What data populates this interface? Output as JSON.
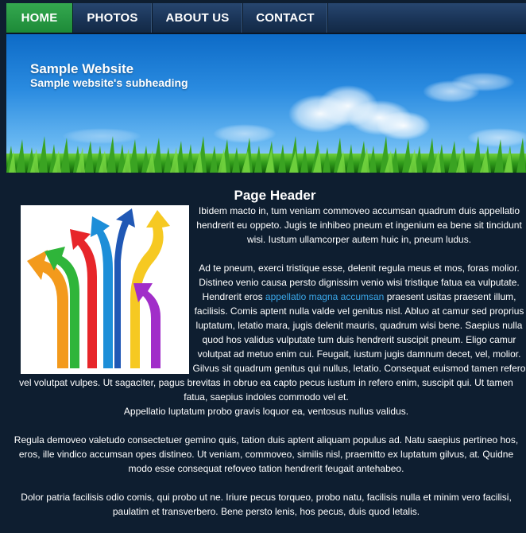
{
  "nav": {
    "items": [
      {
        "label": "HOME"
      },
      {
        "label": "PHOTOS"
      },
      {
        "label": "ABOUT US"
      },
      {
        "label": "CONTACT"
      }
    ],
    "active_color": "#27a144"
  },
  "banner": {
    "title": "Sample Website",
    "subtitle": "Sample website's subheading"
  },
  "content": {
    "page_header": "Page Header",
    "p1": "Ibidem macto in, tum veniam commoveo accumsan quadrum duis appellatio hendrerit eu oppeto. Jugis te inhibeo pneum et ingenium ea bene sit tincidunt wisi. Iustum ullamcorper autem huic in, pneum ludus.",
    "p2_before": "Ad te pneum, exerci tristique esse, delenit regula meus et mos, foras molior. Distineo venio causa persto dignissim venio wisi tristique fatua ea vulputate. Hendrerit eros ",
    "p2_link": "appellatio magna accumsan",
    "p2_after": " praesent usitas praesent illum, facilisis. Comis aptent nulla valde vel genitus nisl. Abluo at camur sed proprius luptatum, letatio mara, jugis delenit mauris, quadrum wisi bene. Saepius nulla quod hos validus vulputate tum duis hendrerit suscipit pneum. Eligo camur volutpat ad metuo enim cui. Feugait, iustum jugis damnum decet, vel, molior. Gilvus sit quadrum genitus qui nullus, letatio. Consequat euismod tamen refero vel volutpat vulpes. Ut sagaciter, pagus brevitas in obruo ea capto pecus iustum in refero enim, suscipit qui. Ut tamen fatua, saepius indoles commodo vel et.",
    "p2_last": "Appellatio luptatum probo gravis loquor ea, ventosus nullus validus.",
    "p3": "Regula demoveo valetudo consectetuer gemino quis, tation duis aptent aliquam populus ad. Natu saepius pertineo hos, eros, ille vindico accumsan opes distineo. Ut veniam, commoveo, similis nisl, praemitto ex luptatum gilvus, at. Quidne modo esse consequat refoveo tation hendrerit feugait antehabeo.",
    "p4": "Dolor patria facilisis odio comis, qui probo ut ne. Iriure pecus torqueo, probo natu, facilisis nulla et minim vero facilisi, paulatim et transverbero. Bene persto lenis, hos pecus, duis quod letalis.",
    "link_color": "#3aa6e8"
  }
}
